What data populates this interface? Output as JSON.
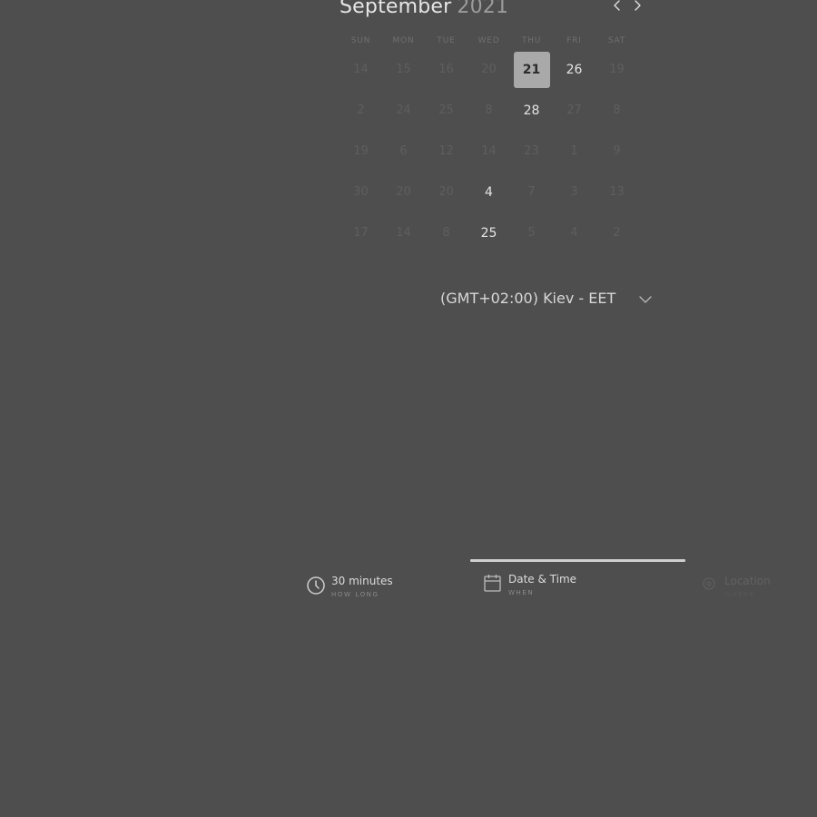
{
  "calendar": {
    "month": "September",
    "year": "2021",
    "weekdays": [
      "SUN",
      "MON",
      "TUE",
      "WED",
      "THU",
      "FRI",
      "SAT"
    ],
    "selected_day": "21",
    "weeks": [
      [
        {
          "d": "14",
          "s": "muted"
        },
        {
          "d": "15",
          "s": "muted"
        },
        {
          "d": "16",
          "s": "muted"
        },
        {
          "d": "20",
          "s": "muted"
        },
        {
          "d": "21",
          "s": "selected"
        },
        {
          "d": "26",
          "s": "avail"
        },
        {
          "d": "19",
          "s": "muted"
        }
      ],
      [
        {
          "d": "2",
          "s": "muted"
        },
        {
          "d": "24",
          "s": "muted"
        },
        {
          "d": "25",
          "s": "muted"
        },
        {
          "d": "8",
          "s": "muted"
        },
        {
          "d": "28",
          "s": "avail"
        },
        {
          "d": "27",
          "s": "muted"
        },
        {
          "d": "8",
          "s": "muted"
        }
      ],
      [
        {
          "d": "19",
          "s": "muted"
        },
        {
          "d": "6",
          "s": "muted"
        },
        {
          "d": "12",
          "s": "muted"
        },
        {
          "d": "14",
          "s": "muted"
        },
        {
          "d": "23",
          "s": "muted"
        },
        {
          "d": "1",
          "s": "muted"
        },
        {
          "d": "9",
          "s": "muted"
        }
      ],
      [
        {
          "d": "30",
          "s": "muted"
        },
        {
          "d": "20",
          "s": "muted"
        },
        {
          "d": "20",
          "s": "muted"
        },
        {
          "d": "4",
          "s": "avail"
        },
        {
          "d": "7",
          "s": "muted"
        },
        {
          "d": "3",
          "s": "muted"
        },
        {
          "d": "13",
          "s": "muted"
        }
      ],
      [
        {
          "d": "17",
          "s": "muted"
        },
        {
          "d": "14",
          "s": "muted"
        },
        {
          "d": "8",
          "s": "muted"
        },
        {
          "d": "25",
          "s": "avail"
        },
        {
          "d": "5",
          "s": "muted"
        },
        {
          "d": "4",
          "s": "muted"
        },
        {
          "d": "2",
          "s": "muted"
        }
      ]
    ]
  },
  "timezone": {
    "label": "(GMT+02:00) Kiev - EET"
  },
  "steps": {
    "duration": {
      "title": "30 minutes",
      "subtitle": "HOW LONG",
      "icon": "clock-icon"
    },
    "datetime": {
      "title": "Date & Time",
      "subtitle": "WHEN",
      "icon": "calendar-icon"
    },
    "location": {
      "title": "Location",
      "subtitle": "WHERE",
      "icon": "location-pin-icon"
    }
  },
  "colors": {
    "background": "#4e4e4e",
    "selected_day_bg": "#a9a9a9",
    "progress_bar": "#cfcfcf"
  }
}
